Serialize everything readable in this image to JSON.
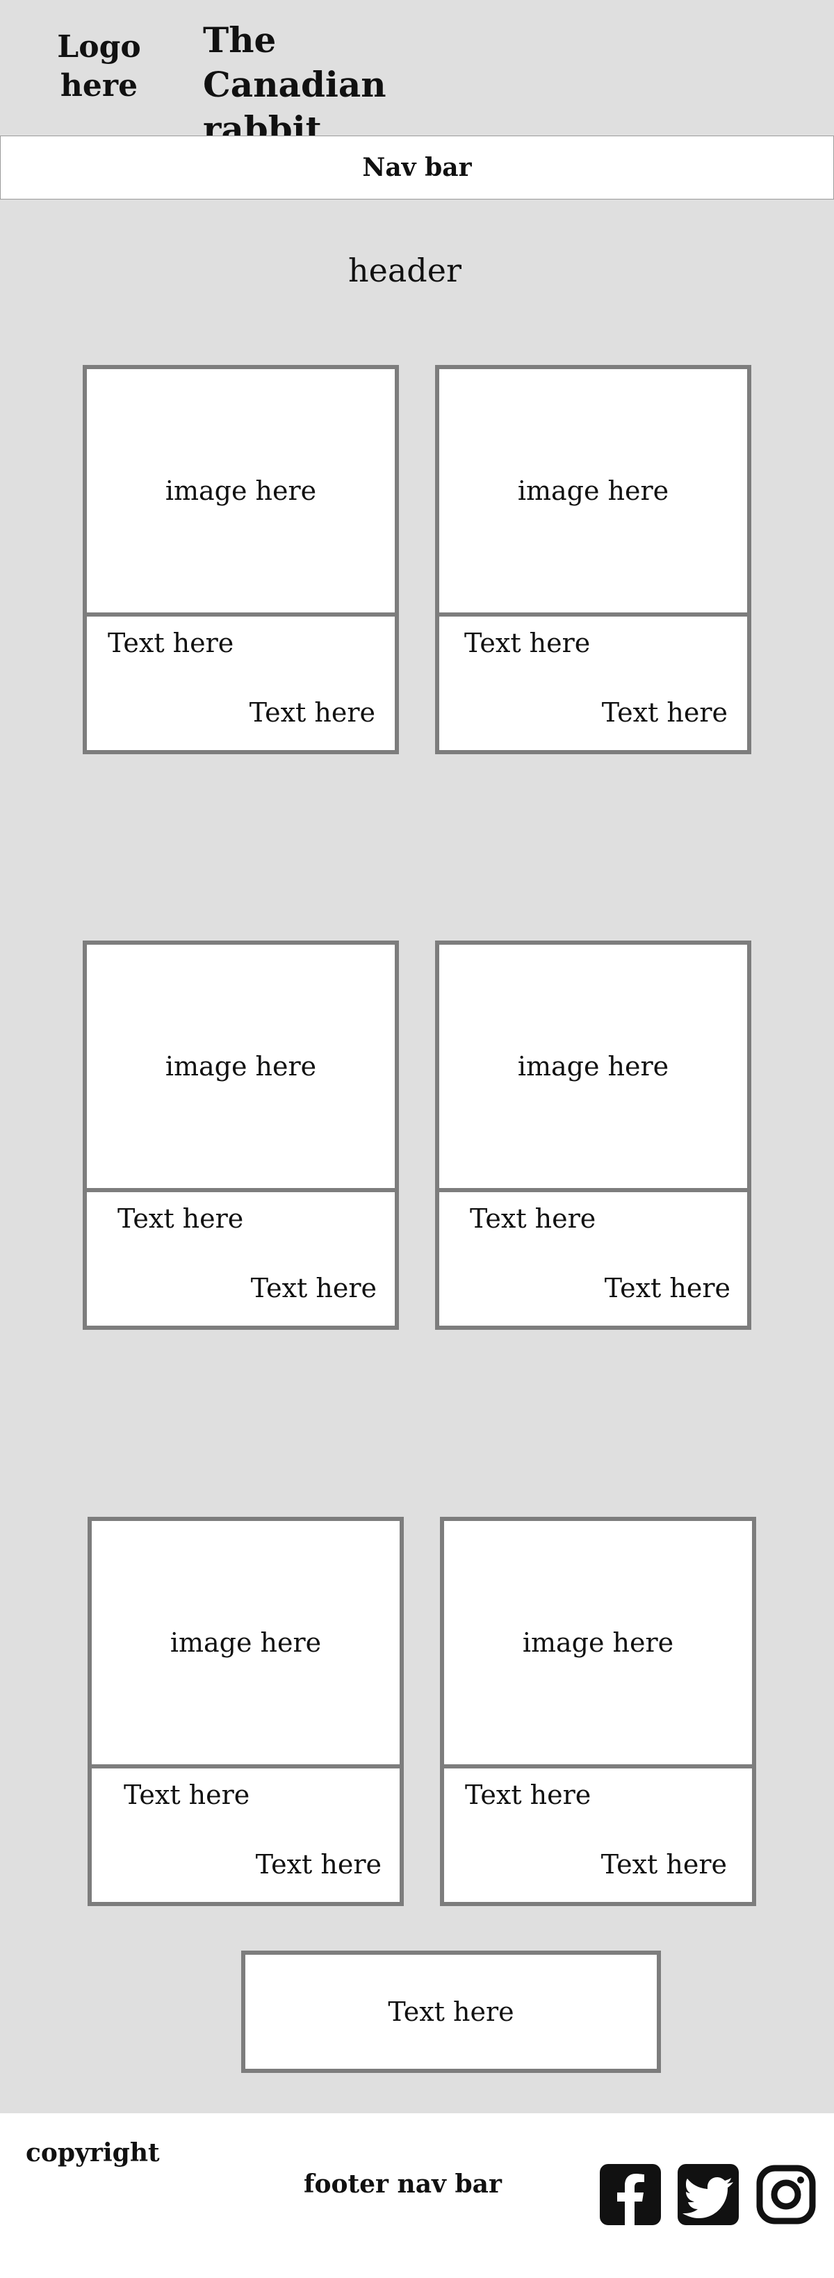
{
  "brand": {
    "logo_line1": "Logo",
    "logo_line2": "here",
    "title_line1": "The Canadian",
    "title_line2": "rabbit shelter"
  },
  "nav": {
    "label": "Nav bar"
  },
  "header": {
    "text": "header"
  },
  "cards": [
    {
      "image": "image here",
      "text_top": "Text here",
      "text_bottom": "Text here"
    },
    {
      "image": "image here",
      "text_top": "Text here",
      "text_bottom": "Text here"
    },
    {
      "image": "image here",
      "text_top": "Text here",
      "text_bottom": "Text here"
    },
    {
      "image": "image here",
      "text_top": "Text here",
      "text_bottom": "Text here"
    },
    {
      "image": "image here",
      "text_top": "Text here",
      "text_bottom": "Text here"
    },
    {
      "image": "image here",
      "text_top": "Text here",
      "text_bottom": "Text here"
    }
  ],
  "cta": {
    "text": "Text here"
  },
  "footer": {
    "copyright": "copyright",
    "nav_label": "footer nav bar",
    "social_icons": [
      "facebook-icon",
      "twitter-icon",
      "instagram-icon"
    ]
  }
}
